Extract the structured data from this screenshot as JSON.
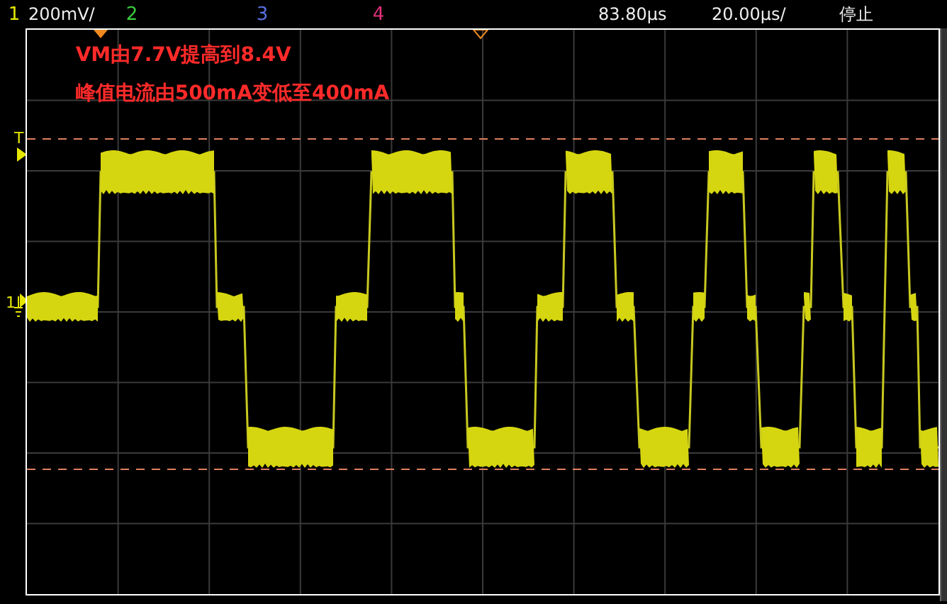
{
  "top_bar": {
    "channels": [
      {
        "label": "1",
        "color": "#e6e600",
        "scale": "200mV/"
      },
      {
        "label": "2",
        "color": "#3ccf3c"
      },
      {
        "label": "3",
        "color": "#5b6fe0"
      },
      {
        "label": "4",
        "color": "#e0307a"
      }
    ],
    "delay": "83.80μs",
    "timebase": "20.00μs/",
    "status": "停止"
  },
  "screen": {
    "annotations": [
      "VM由7.7V提高到8.4V",
      "峰值电流由500mA变低至400mA"
    ],
    "trigger_marker": "T",
    "channel_marker": "1"
  }
}
